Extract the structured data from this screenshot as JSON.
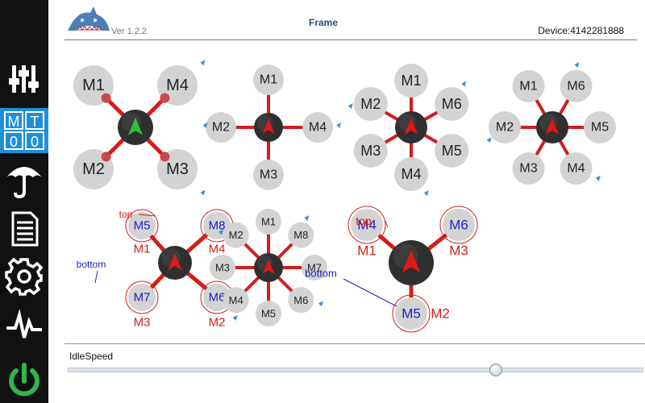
{
  "app": {
    "version": "Ver 1.2.2",
    "device": "Device:4142281888"
  },
  "header": {
    "title": "Frame"
  },
  "sidebar": {
    "items": [
      {
        "name": "tuning-sliders-icon",
        "selected": false
      },
      {
        "name": "motor-test-icon",
        "selected": true,
        "text": [
          "M",
          "T",
          "0",
          "0"
        ]
      },
      {
        "name": "failsafe-umbrella-icon",
        "selected": false
      },
      {
        "name": "log-document-icon",
        "selected": false
      },
      {
        "name": "settings-gear-icon",
        "selected": false
      },
      {
        "name": "signal-waveform-icon",
        "selected": false
      },
      {
        "name": "power-icon",
        "selected": false,
        "color": "#2fb64a"
      }
    ]
  },
  "frames": [
    {
      "type": "quad-x",
      "motors": [
        "M1",
        "M4",
        "M2",
        "M3"
      ],
      "arrow_color": "#2fbf3a"
    },
    {
      "type": "quad-plus",
      "motors": [
        "M1",
        "M4",
        "M3",
        "M2"
      ]
    },
    {
      "type": "hexa-x",
      "motors": [
        "M1",
        "M6",
        "M5",
        "M4",
        "M3",
        "M2"
      ]
    },
    {
      "type": "hexa-plus",
      "motors": [
        "M1",
        "M6",
        "M5",
        "M4",
        "M3",
        "M2"
      ]
    },
    {
      "type": "quad-x-coaxial",
      "top": [
        "M5",
        "M8",
        "M7",
        "M6"
      ],
      "bottom": [
        "M1",
        "M4",
        "M3",
        "M2"
      ],
      "top_label": "top",
      "bottom_label": "bottom"
    },
    {
      "type": "octo",
      "motors": [
        "M1",
        "M8",
        "M7",
        "M6",
        "M5",
        "M4",
        "M3",
        "M2"
      ]
    },
    {
      "type": "y6",
      "top": [
        "M4",
        "M6",
        "M5"
      ],
      "bottom": [
        "M1",
        "M3",
        "M2"
      ],
      "top_label": "top",
      "bottom_label": "bottom"
    }
  ],
  "colors": {
    "arm": "#d21d1d",
    "hub": "#2f2f2f",
    "arrow": "#e01818",
    "motor": "#d3d3d3",
    "motor_label": "#222222",
    "spin": "#3b8fd6",
    "sub_label": "#d21d1d",
    "coax_top": "#2020c8",
    "accent": "#1f4f7a"
  },
  "idle": {
    "label": "IdleSpeed",
    "value": 0.745
  }
}
